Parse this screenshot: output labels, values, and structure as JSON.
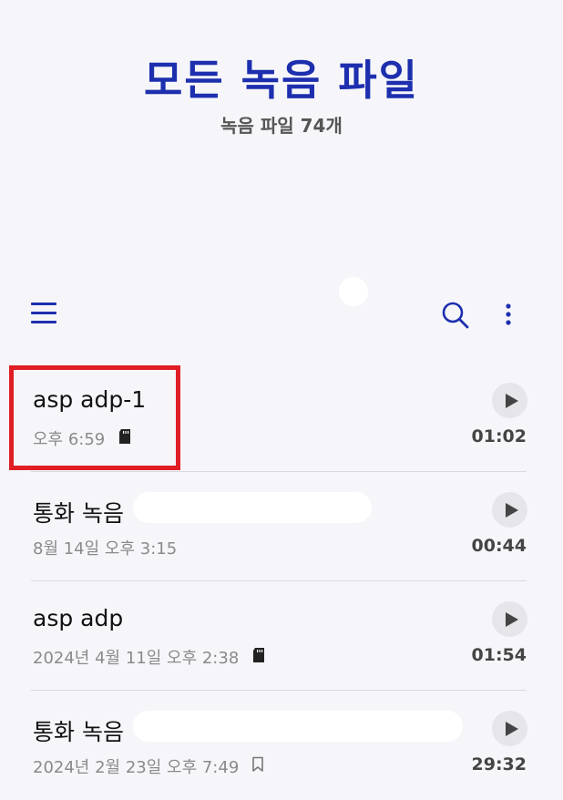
{
  "header": {
    "title": "모든 녹음 파일",
    "subtitle": "녹음 파일 74개"
  },
  "toolbar": {
    "menu_icon": "hamburger-menu-icon",
    "search_icon": "search-icon",
    "more_icon": "more-vertical-icon"
  },
  "recordings": [
    {
      "title": "asp adp-1",
      "datetime": "오후 6:59",
      "icon": "sd-card-icon",
      "duration": "01:02"
    },
    {
      "title": "통화 녹음",
      "datetime": "8월 14일 오후 3:15",
      "icon": "",
      "duration": "00:44"
    },
    {
      "title": "asp adp",
      "datetime": "2024년 4월 11일 오후 2:38",
      "icon": "sd-card-icon",
      "duration": "01:54"
    },
    {
      "title": "통화 녹음",
      "datetime": "2024년 2월 23일 오후 7:49",
      "icon": "bookmark-icon",
      "duration": "29:32"
    }
  ],
  "colors": {
    "accent": "#1d2fae",
    "highlight": "#e01e25",
    "background": "#f6f6fa"
  }
}
